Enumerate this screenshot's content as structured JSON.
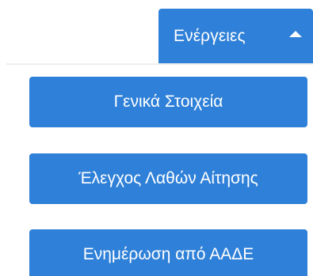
{
  "actions": {
    "toggle_label": "Ενέργειες",
    "items": [
      {
        "label": "Γενικά Στοιχεία"
      },
      {
        "label": "Έλεγχος Λαθών Αίτησης"
      },
      {
        "label": "Ενημέρωση από ΑΑΔΕ"
      }
    ]
  },
  "colors": {
    "button_bg": "#2f80d8",
    "button_text": "#ffffff"
  },
  "icons": {
    "toggle_icon": "caret-up-icon"
  }
}
